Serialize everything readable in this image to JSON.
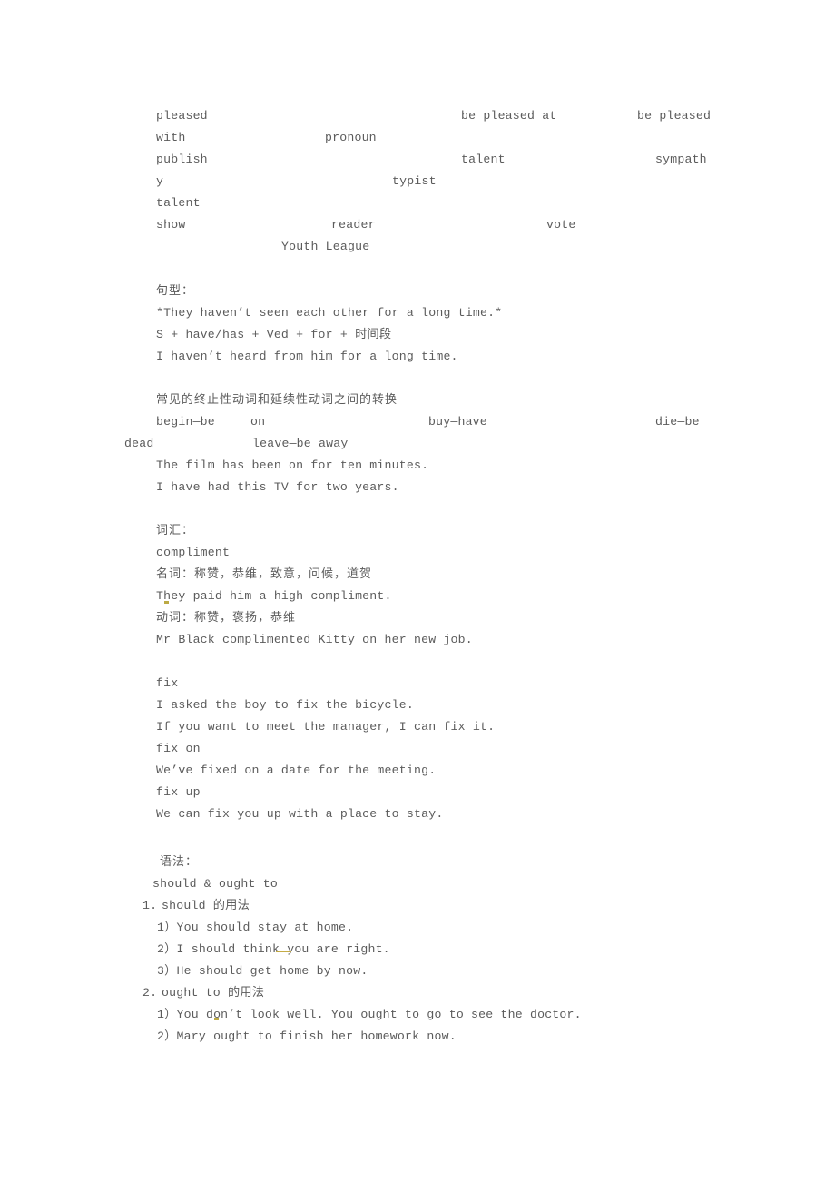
{
  "document": {
    "type": "study-notes",
    "language": "zh-CN/en",
    "text_color": "#5b5b5b",
    "background_color": "#ffffff"
  },
  "word_block": {
    "line1": {
      "a": "pleased",
      "b": "be pleased at",
      "c": "be pleased"
    },
    "line2": {
      "a": "with",
      "b": "pronoun"
    },
    "line3": {
      "a": "publish",
      "b": "talent",
      "c": "sympath"
    },
    "line4": {
      "a": "y",
      "b": "typist"
    },
    "line5": {
      "a": "talent"
    },
    "line6": {
      "a": "show",
      "b": "reader",
      "c": "vote"
    },
    "line7": {
      "a": "Youth League"
    }
  },
  "sentence_pattern": {
    "heading": "句型：",
    "lines": [
      "*They haven’t seen each other for a long time.*",
      "S + have/has + Ved + for + 时间段",
      "I haven’t heard from him for a long time."
    ]
  },
  "conversion": {
    "heading": "常见的终止性动词和延续性动词之间的转换",
    "pair1": "begin—be",
    "pair1b": "on",
    "pair2": "buy—have",
    "pair3": "die—be",
    "pair3b": "dead",
    "pair4": "leave—be away",
    "examples": [
      "The film has been on for ten minutes.",
      "I have had this TV for two years."
    ]
  },
  "vocabulary": {
    "heading": "词汇：",
    "entries": [
      {
        "word": "compliment",
        "noun_label": "名词：称赞，恭维，致意，问候，道贺",
        "noun_example": "They paid him a high compliment.",
        "verb_label": "动词：称赞，褒扬，恭维",
        "verb_example": "Mr Black complimented Kitty on her new job."
      },
      {
        "word": "fix",
        "examples": [
          "I asked the boy to fix the bicycle.",
          "If you want to meet the manager, I can fix it."
        ],
        "phrase1": "fix on",
        "phrase1_example": "We’ve fixed on a date for the meeting.",
        "phrase2": "fix up",
        "phrase2_example": "We can fix you up with a place to stay."
      }
    ]
  },
  "grammar": {
    "heading": "语法：",
    "topic": "should & ought to",
    "sections": [
      {
        "number": "1.",
        "title": "should 的用法",
        "items": [
          "1）You should stay at home.",
          "2）I should think you are right.",
          "3）He should get home by now."
        ]
      },
      {
        "number": "2.",
        "title": "ought to 的用法",
        "items": [
          "1）You don’t look well. You ought to go to see the doctor.",
          "2）Mary ought to finish her homework now."
        ]
      }
    ]
  }
}
